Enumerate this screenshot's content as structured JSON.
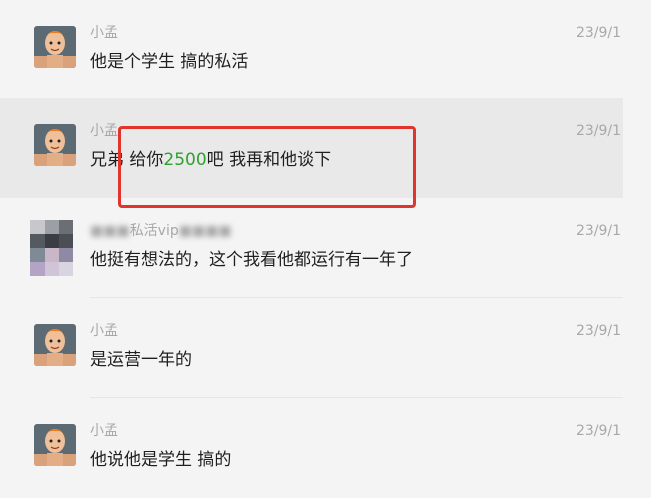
{
  "messages": [
    {
      "sender": "小孟",
      "time": "23/9/1",
      "text": "他是个学生  搞的私活"
    },
    {
      "sender": "小孟",
      "time": "23/9/1",
      "text_before": "兄弟  给你",
      "amount": "2500",
      "text_after": "吧   我再和他谈下"
    },
    {
      "sender": "私活vip",
      "time": "23/9/1",
      "text": "他挺有想法的，这个我看他都运行有一年了"
    },
    {
      "sender": "小孟",
      "time": "23/9/1",
      "text": "是运营一年的"
    },
    {
      "sender": "小孟",
      "time": "23/9/1",
      "text": "他说他是学生 搞的"
    }
  ],
  "colors": {
    "background": "#f4f4f4",
    "highlight": "#e9e9e9",
    "amount": "#2ea12e",
    "annotation_box": "#e0342c",
    "meta_text": "#a8a8a8"
  },
  "icons": [
    "avatar-cartoon-boy-orange-hair",
    "avatar-blurred"
  ]
}
